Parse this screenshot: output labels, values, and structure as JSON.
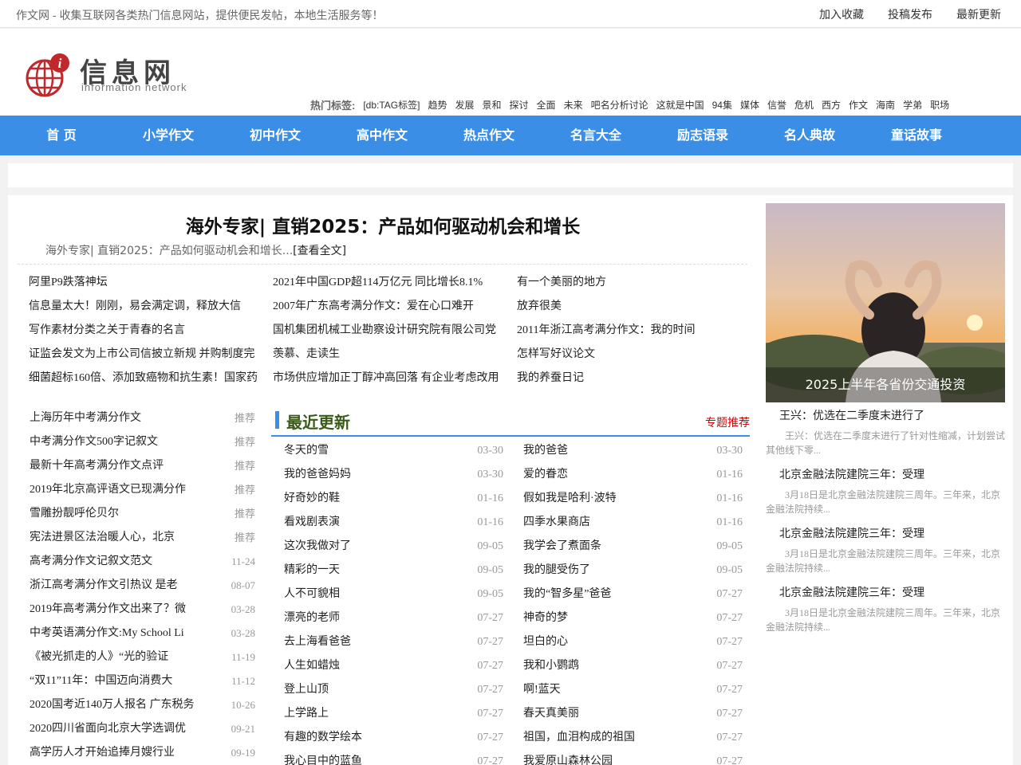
{
  "topbar": {
    "slogan": "作文网 - 收集互联网各类热门信息网站，提供便民发帖，本地生活服务等！",
    "links": [
      "加入收藏",
      "投稿发布",
      "最新更新"
    ]
  },
  "logo": {
    "cn": "信息网",
    "en": "information network"
  },
  "hottags": {
    "label": "热门标签:",
    "tags": [
      "[db:TAG标签]",
      "趋势",
      "发展",
      "景和",
      "探讨",
      "全面",
      "未来",
      "吧名分析讨论",
      "这就是中国",
      "94集",
      "媒体",
      "信誉",
      "危机",
      "西方",
      "作文",
      "海南",
      "学弟",
      "职场"
    ]
  },
  "nav": [
    "首 页",
    "小学作文",
    "初中作文",
    "高中作文",
    "热点作文",
    "名言大全",
    "励志语录",
    "名人典故",
    "童话故事"
  ],
  "headline": {
    "title": "海外专家| 直销2025：产品如何驱动机会和增长",
    "summary": "海外专家| 直销2025：产品如何驱动机会和增长...",
    "more": "[查看全文]"
  },
  "grid": {
    "col1": [
      "阿里P9跌落神坛",
      "信息量太大！刚刚，易会满定调，释放大信",
      "写作素材分类之关于青春的名言",
      "证监会发文为上市公司信披立新规 并购制度完",
      "细菌超标160倍、添加致癌物和抗生素！国家药"
    ],
    "col2": [
      "2021年中国GDP超114万亿元 同比增长8.1%",
      "2007年广东高考满分作文：爱在心口难开",
      "国机集团机械工业勘察设计研究院有限公司党",
      "羡慕、走读生",
      "市场供应增加正丁醇冲高回落 有企业考虑改用"
    ],
    "col3": [
      "有一个美丽的地方",
      "放弃很美",
      "2011年浙江高考满分作文：我的时间",
      "怎样写好议论文",
      "我的养蚕日记"
    ]
  },
  "leftlist": [
    {
      "t": "上海历年中考满分作文",
      "d": "推荐"
    },
    {
      "t": "中考满分作文500字记叙文",
      "d": "推荐"
    },
    {
      "t": "最新十年高考满分作文点评",
      "d": "推荐"
    },
    {
      "t": "2019年北京高评语文已现满分作",
      "d": "推荐"
    },
    {
      "t": "雪雕扮靓呼伦贝尔",
      "d": "推荐"
    },
    {
      "t": "宪法进景区法治暖人心，北京",
      "d": "推荐"
    },
    {
      "t": "高考满分作文记叙文范文",
      "d": "11-24"
    },
    {
      "t": "浙江高考满分作文引热议 是老",
      "d": "08-07"
    },
    {
      "t": "2019年高考满分作文出来了？微",
      "d": "03-28"
    },
    {
      "t": "中考英语满分作文:My School Li",
      "d": "03-28"
    },
    {
      "t": "《被光抓走的人》“光的验证",
      "d": "11-19"
    },
    {
      "t": "“双11”11年：中国迈向消费大",
      "d": "11-12"
    },
    {
      "t": "2020国考近140万人报名 广东税务",
      "d": "10-26"
    },
    {
      "t": "2020四川省面向北京大学选调优",
      "d": "09-21"
    },
    {
      "t": "高学历人才开始追捧月嫂行业",
      "d": "09-19"
    }
  ],
  "recent": {
    "title": "最近更新",
    "sub": "专题推荐",
    "left": [
      {
        "t": "冬天的雪",
        "d": "03-30"
      },
      {
        "t": "我的爸爸妈妈",
        "d": "03-30"
      },
      {
        "t": "好奇妙的鞋",
        "d": "01-16"
      },
      {
        "t": "看戏剧表演",
        "d": "01-16"
      },
      {
        "t": "这次我做对了",
        "d": "09-05"
      },
      {
        "t": "精彩的一天",
        "d": "09-05"
      },
      {
        "t": "人不可貌相",
        "d": "09-05"
      },
      {
        "t": "漂亮的老师",
        "d": "07-27"
      },
      {
        "t": "去上海看爸爸",
        "d": "07-27"
      },
      {
        "t": "人生如蜡烛",
        "d": "07-27"
      },
      {
        "t": "登上山顶",
        "d": "07-27"
      },
      {
        "t": "上学路上",
        "d": "07-27"
      },
      {
        "t": "有趣的数学绘本",
        "d": "07-27"
      },
      {
        "t": "我心目中的蓝鱼",
        "d": "07-27"
      }
    ],
    "right": [
      {
        "t": "我的爸爸",
        "d": "03-30"
      },
      {
        "t": "爱的眷恋",
        "d": "01-16"
      },
      {
        "t": "假如我是哈利·波特",
        "d": "01-16"
      },
      {
        "t": "四季水果商店",
        "d": "01-16"
      },
      {
        "t": "我学会了煮面条",
        "d": "09-05"
      },
      {
        "t": "我的腿受伤了",
        "d": "09-05"
      },
      {
        "t": "我的“智多星”爸爸",
        "d": "07-27"
      },
      {
        "t": "神奇的梦",
        "d": "07-27"
      },
      {
        "t": "坦白的心",
        "d": "07-27"
      },
      {
        "t": "我和小鹦鹉",
        "d": "07-27"
      },
      {
        "t": "啊!蓝天",
        "d": "07-27"
      },
      {
        "t": "春天真美丽",
        "d": "07-27"
      },
      {
        "t": "祖国，血泪构成的祖国",
        "d": "07-27"
      },
      {
        "t": "我爱原山森林公园",
        "d": "07-27"
      }
    ]
  },
  "side": {
    "caption": "2025上半年各省份交通投资",
    "news": [
      {
        "t": "王兴：优选在二季度末进行了",
        "d": "王兴：优选在二季度末进行了针对性缩减，计划尝试其他线下零..."
      },
      {
        "t": "北京金融法院建院三年：受理",
        "d": "3月18日是北京金融法院建院三周年。三年来，北京金融法院持续..."
      },
      {
        "t": "北京金融法院建院三年：受理",
        "d": "3月18日是北京金融法院建院三周年。三年来，北京金融法院持续..."
      },
      {
        "t": "北京金融法院建院三年：受理",
        "d": "3月18日是北京金融法院建院三周年。三年来，北京金融法院持续..."
      }
    ]
  }
}
